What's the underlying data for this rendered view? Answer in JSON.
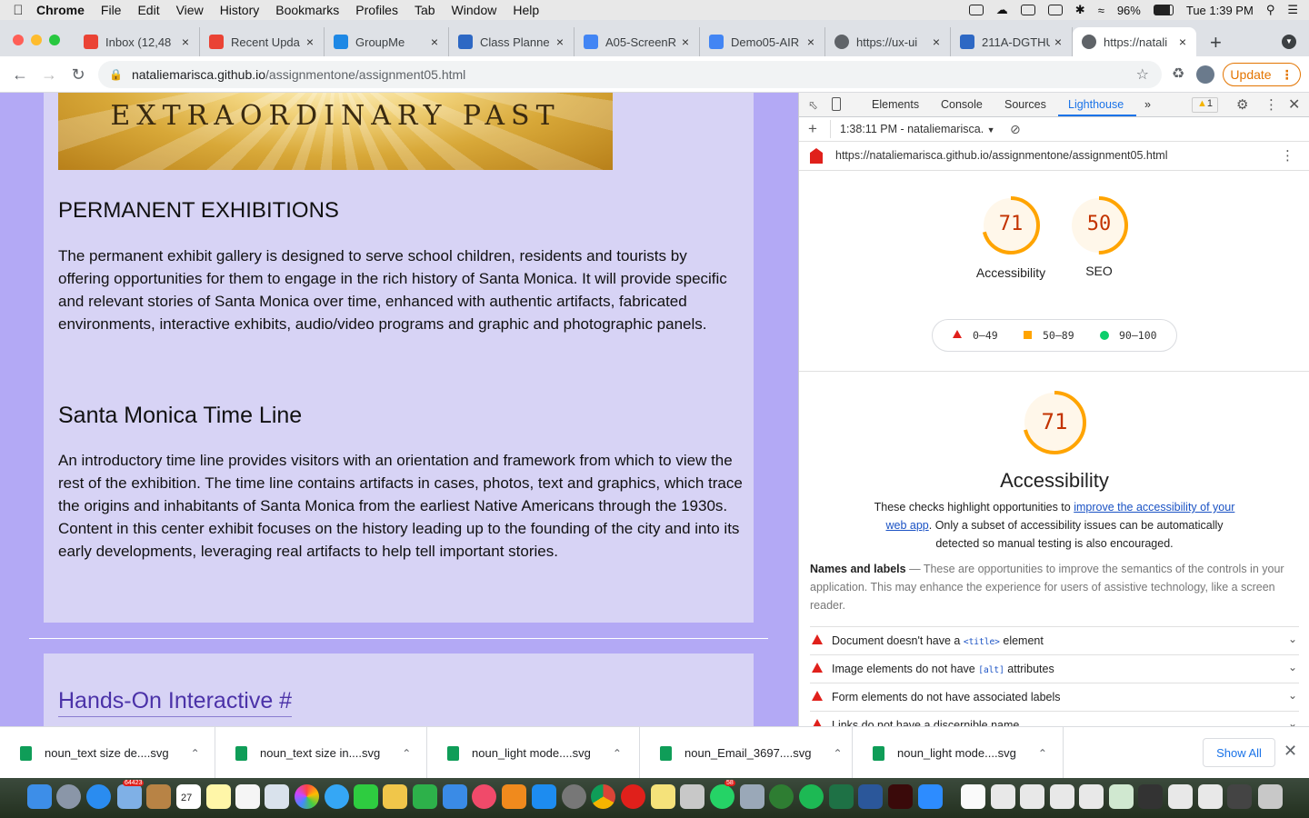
{
  "menubar": {
    "app": "Chrome",
    "items": [
      "File",
      "Edit",
      "View",
      "History",
      "Bookmarks",
      "Profiles",
      "Tab",
      "Window",
      "Help"
    ],
    "battery": "96%",
    "clock": "Tue 1:39 PM"
  },
  "tabs": [
    {
      "title": "Inbox (12,48",
      "icon": "gmail-icon",
      "color": "#ea4335"
    },
    {
      "title": "Recent Upda",
      "icon": "gmail-icon",
      "color": "#ea4335"
    },
    {
      "title": "GroupMe",
      "icon": "groupme-icon",
      "color": "#1e88e5"
    },
    {
      "title": "Class Planne",
      "icon": "ucla-icon",
      "color": "#2d68c4"
    },
    {
      "title": "A05-ScreenR",
      "icon": "docs-icon",
      "color": "#4285f4"
    },
    {
      "title": "Demo05-AIR",
      "icon": "docs-icon",
      "color": "#4285f4"
    },
    {
      "title": "https://ux-ui",
      "icon": "globe-icon",
      "color": "#5f6368"
    },
    {
      "title": "211A-DGTHU",
      "icon": "ucla-icon",
      "color": "#2d68c4"
    },
    {
      "title": "https://natali",
      "icon": "globe-icon",
      "color": "#5f6368",
      "active": true
    }
  ],
  "toolbar": {
    "url_host": "nataliemarisca.github.io",
    "url_path": "/assignmentone/assignment05.html",
    "update_label": "Update"
  },
  "page": {
    "banner_text": "EXTRAORDINARY PAST",
    "section1_heading": "PERMANENT EXHIBITIONS",
    "section1_body": "The permanent exhibit gallery is designed to serve school children, residents and tourists by offering opportunities for them to engage in the rich history of Santa Monica. It will provide specific and relevant stories of Santa Monica over time, enhanced with authentic artifacts, fabricated environments, interactive exhibits, audio/video programs and graphic and photographic panels.",
    "section2_heading": "Santa Monica Time Line",
    "section2_body": "An introductory time line provides visitors with an orientation and framework from which to view the rest of the exhibition. The time line contains artifacts in cases, photos, text and graphics, which trace the origins and inhabitants of Santa Monica from the earliest Native Americans through the 1930s. Content in this center exhibit focuses on the history leading up to the founding of the city and into its early developments, leveraging real artifacts to help tell important stories.",
    "section3_heading": "Hands-On Interactive #"
  },
  "devtools": {
    "tabs": [
      "Elements",
      "Console",
      "Sources",
      "Lighthouse",
      "»"
    ],
    "active_tab": "Lighthouse",
    "warning_count": "1",
    "report_time": "1:38:11 PM - nataliemarisca.",
    "report_url": "https://nataliemarisca.github.io/assignmentone/assignment05.html",
    "scores": [
      {
        "value": "71",
        "label": "Accessibility",
        "fraction": 0.71
      },
      {
        "value": "50",
        "label": "SEO",
        "fraction": 0.5
      }
    ],
    "legend": [
      {
        "range": "0–49",
        "color": "#e0201b"
      },
      {
        "range": "50–89",
        "color": "#ffa400"
      },
      {
        "range": "90–100",
        "color": "#0cce6b"
      }
    ],
    "main_score": "71",
    "main_fraction": 0.71,
    "main_title": "Accessibility",
    "desc_before": "These checks highlight opportunities to ",
    "desc_link": "improve the accessibility of your web app",
    "desc_after": ". Only a subset of accessibility issues can be automatically detected so manual testing is also encouraged.",
    "group_title": "Names and labels",
    "group_desc": " — These are opportunities to improve the semantics of the controls in your application. This may enhance the experience for users of assistive technology, like a screen reader.",
    "audits": [
      {
        "before": "Document doesn't have a ",
        "code": "<title>",
        "after": " element"
      },
      {
        "before": "Image elements do not have ",
        "code": "[alt]",
        "after": " attributes"
      },
      {
        "before": "Form elements do not have associated labels",
        "code": "",
        "after": ""
      },
      {
        "before": "Links do not have a discernible name",
        "code": "",
        "after": ""
      }
    ]
  },
  "downloads": {
    "items": [
      "noun_text size de....svg",
      "noun_text size in....svg",
      "noun_light mode....svg",
      "noun_Email_3697....svg",
      "noun_light mode....svg"
    ],
    "show_all": "Show All"
  },
  "dock": {
    "badge_mail": "64423",
    "badge_cal": "27",
    "badge_whatsapp": "58"
  }
}
